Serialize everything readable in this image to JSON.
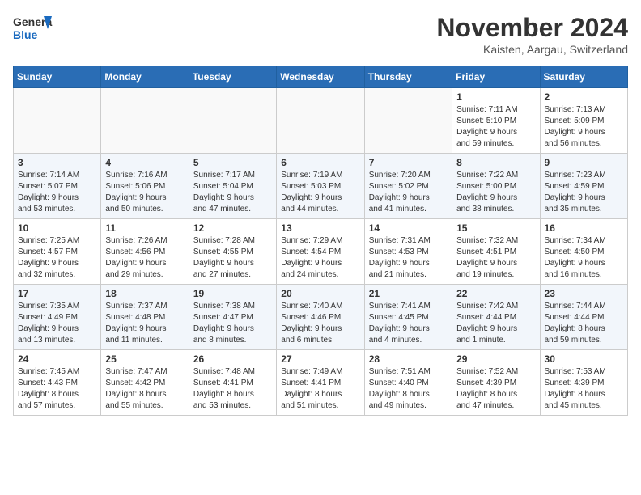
{
  "header": {
    "logo_general": "General",
    "logo_blue": "Blue",
    "month_title": "November 2024",
    "location": "Kaisten, Aargau, Switzerland"
  },
  "calendar": {
    "weekdays": [
      "Sunday",
      "Monday",
      "Tuesday",
      "Wednesday",
      "Thursday",
      "Friday",
      "Saturday"
    ],
    "weeks": [
      [
        {
          "day": "",
          "info": ""
        },
        {
          "day": "",
          "info": ""
        },
        {
          "day": "",
          "info": ""
        },
        {
          "day": "",
          "info": ""
        },
        {
          "day": "",
          "info": ""
        },
        {
          "day": "1",
          "info": "Sunrise: 7:11 AM\nSunset: 5:10 PM\nDaylight: 9 hours\nand 59 minutes."
        },
        {
          "day": "2",
          "info": "Sunrise: 7:13 AM\nSunset: 5:09 PM\nDaylight: 9 hours\nand 56 minutes."
        }
      ],
      [
        {
          "day": "3",
          "info": "Sunrise: 7:14 AM\nSunset: 5:07 PM\nDaylight: 9 hours\nand 53 minutes."
        },
        {
          "day": "4",
          "info": "Sunrise: 7:16 AM\nSunset: 5:06 PM\nDaylight: 9 hours\nand 50 minutes."
        },
        {
          "day": "5",
          "info": "Sunrise: 7:17 AM\nSunset: 5:04 PM\nDaylight: 9 hours\nand 47 minutes."
        },
        {
          "day": "6",
          "info": "Sunrise: 7:19 AM\nSunset: 5:03 PM\nDaylight: 9 hours\nand 44 minutes."
        },
        {
          "day": "7",
          "info": "Sunrise: 7:20 AM\nSunset: 5:02 PM\nDaylight: 9 hours\nand 41 minutes."
        },
        {
          "day": "8",
          "info": "Sunrise: 7:22 AM\nSunset: 5:00 PM\nDaylight: 9 hours\nand 38 minutes."
        },
        {
          "day": "9",
          "info": "Sunrise: 7:23 AM\nSunset: 4:59 PM\nDaylight: 9 hours\nand 35 minutes."
        }
      ],
      [
        {
          "day": "10",
          "info": "Sunrise: 7:25 AM\nSunset: 4:57 PM\nDaylight: 9 hours\nand 32 minutes."
        },
        {
          "day": "11",
          "info": "Sunrise: 7:26 AM\nSunset: 4:56 PM\nDaylight: 9 hours\nand 29 minutes."
        },
        {
          "day": "12",
          "info": "Sunrise: 7:28 AM\nSunset: 4:55 PM\nDaylight: 9 hours\nand 27 minutes."
        },
        {
          "day": "13",
          "info": "Sunrise: 7:29 AM\nSunset: 4:54 PM\nDaylight: 9 hours\nand 24 minutes."
        },
        {
          "day": "14",
          "info": "Sunrise: 7:31 AM\nSunset: 4:53 PM\nDaylight: 9 hours\nand 21 minutes."
        },
        {
          "day": "15",
          "info": "Sunrise: 7:32 AM\nSunset: 4:51 PM\nDaylight: 9 hours\nand 19 minutes."
        },
        {
          "day": "16",
          "info": "Sunrise: 7:34 AM\nSunset: 4:50 PM\nDaylight: 9 hours\nand 16 minutes."
        }
      ],
      [
        {
          "day": "17",
          "info": "Sunrise: 7:35 AM\nSunset: 4:49 PM\nDaylight: 9 hours\nand 13 minutes."
        },
        {
          "day": "18",
          "info": "Sunrise: 7:37 AM\nSunset: 4:48 PM\nDaylight: 9 hours\nand 11 minutes."
        },
        {
          "day": "19",
          "info": "Sunrise: 7:38 AM\nSunset: 4:47 PM\nDaylight: 9 hours\nand 8 minutes."
        },
        {
          "day": "20",
          "info": "Sunrise: 7:40 AM\nSunset: 4:46 PM\nDaylight: 9 hours\nand 6 minutes."
        },
        {
          "day": "21",
          "info": "Sunrise: 7:41 AM\nSunset: 4:45 PM\nDaylight: 9 hours\nand 4 minutes."
        },
        {
          "day": "22",
          "info": "Sunrise: 7:42 AM\nSunset: 4:44 PM\nDaylight: 9 hours\nand 1 minute."
        },
        {
          "day": "23",
          "info": "Sunrise: 7:44 AM\nSunset: 4:44 PM\nDaylight: 8 hours\nand 59 minutes."
        }
      ],
      [
        {
          "day": "24",
          "info": "Sunrise: 7:45 AM\nSunset: 4:43 PM\nDaylight: 8 hours\nand 57 minutes."
        },
        {
          "day": "25",
          "info": "Sunrise: 7:47 AM\nSunset: 4:42 PM\nDaylight: 8 hours\nand 55 minutes."
        },
        {
          "day": "26",
          "info": "Sunrise: 7:48 AM\nSunset: 4:41 PM\nDaylight: 8 hours\nand 53 minutes."
        },
        {
          "day": "27",
          "info": "Sunrise: 7:49 AM\nSunset: 4:41 PM\nDaylight: 8 hours\nand 51 minutes."
        },
        {
          "day": "28",
          "info": "Sunrise: 7:51 AM\nSunset: 4:40 PM\nDaylight: 8 hours\nand 49 minutes."
        },
        {
          "day": "29",
          "info": "Sunrise: 7:52 AM\nSunset: 4:39 PM\nDaylight: 8 hours\nand 47 minutes."
        },
        {
          "day": "30",
          "info": "Sunrise: 7:53 AM\nSunset: 4:39 PM\nDaylight: 8 hours\nand 45 minutes."
        }
      ]
    ]
  }
}
